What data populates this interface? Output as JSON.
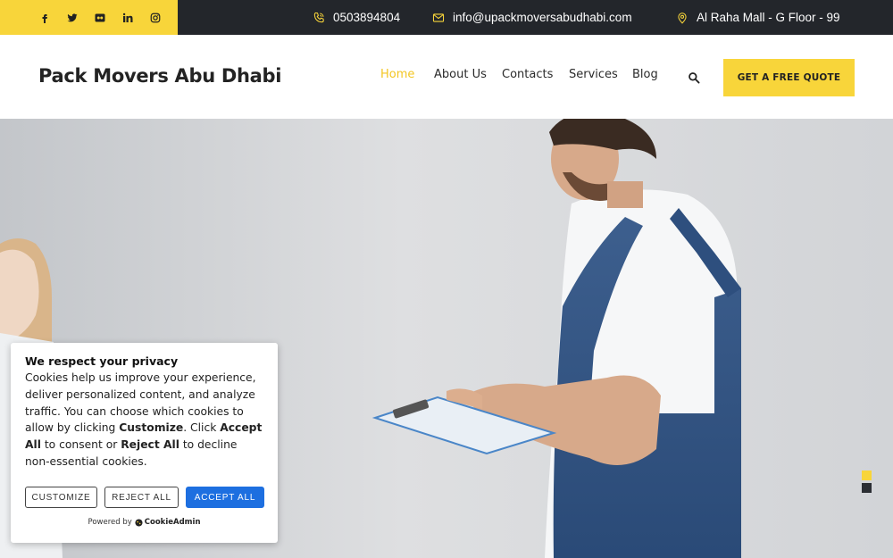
{
  "topbar": {
    "social_icons": [
      "facebook-icon",
      "twitter-icon",
      "flickr-icon",
      "linkedin-icon",
      "instagram-icon"
    ],
    "phone": "0503894804",
    "email": "info@upackmoversabudhabi.com",
    "address": "Al Raha Mall - G Floor - 99"
  },
  "header": {
    "logo": "Pack Movers Abu Dhabi",
    "nav": [
      {
        "label": "Home",
        "active": true
      },
      {
        "label": "About Us",
        "active": false
      },
      {
        "label": "Contacts",
        "active": false
      },
      {
        "label": "Services",
        "active": false
      },
      {
        "label": "Blog",
        "active": false
      }
    ],
    "quote_button": "GET A FREE QUOTE"
  },
  "cookie": {
    "title": "We respect your privacy",
    "text_1": "Cookies help us improve your experience, deliver personalized content, and analyze traffic. You can choose which cookies to allow by clicking ",
    "customize_word": "Customize",
    "text_2": ". Click ",
    "accept_word": "Accept All",
    "text_3": " to consent or ",
    "reject_word": "Reject All",
    "text_4": " to decline non-essential cookies.",
    "customize_button": "CUSTOMIZE",
    "reject_button": "REJECT ALL",
    "accept_button": "ACCEPT ALL",
    "powered_by": "Powered by",
    "brand": "CookieAdmin"
  },
  "colors": {
    "accent": "#f8d53a",
    "dark": "#23262b",
    "accept_blue": "#1d6fe0"
  }
}
